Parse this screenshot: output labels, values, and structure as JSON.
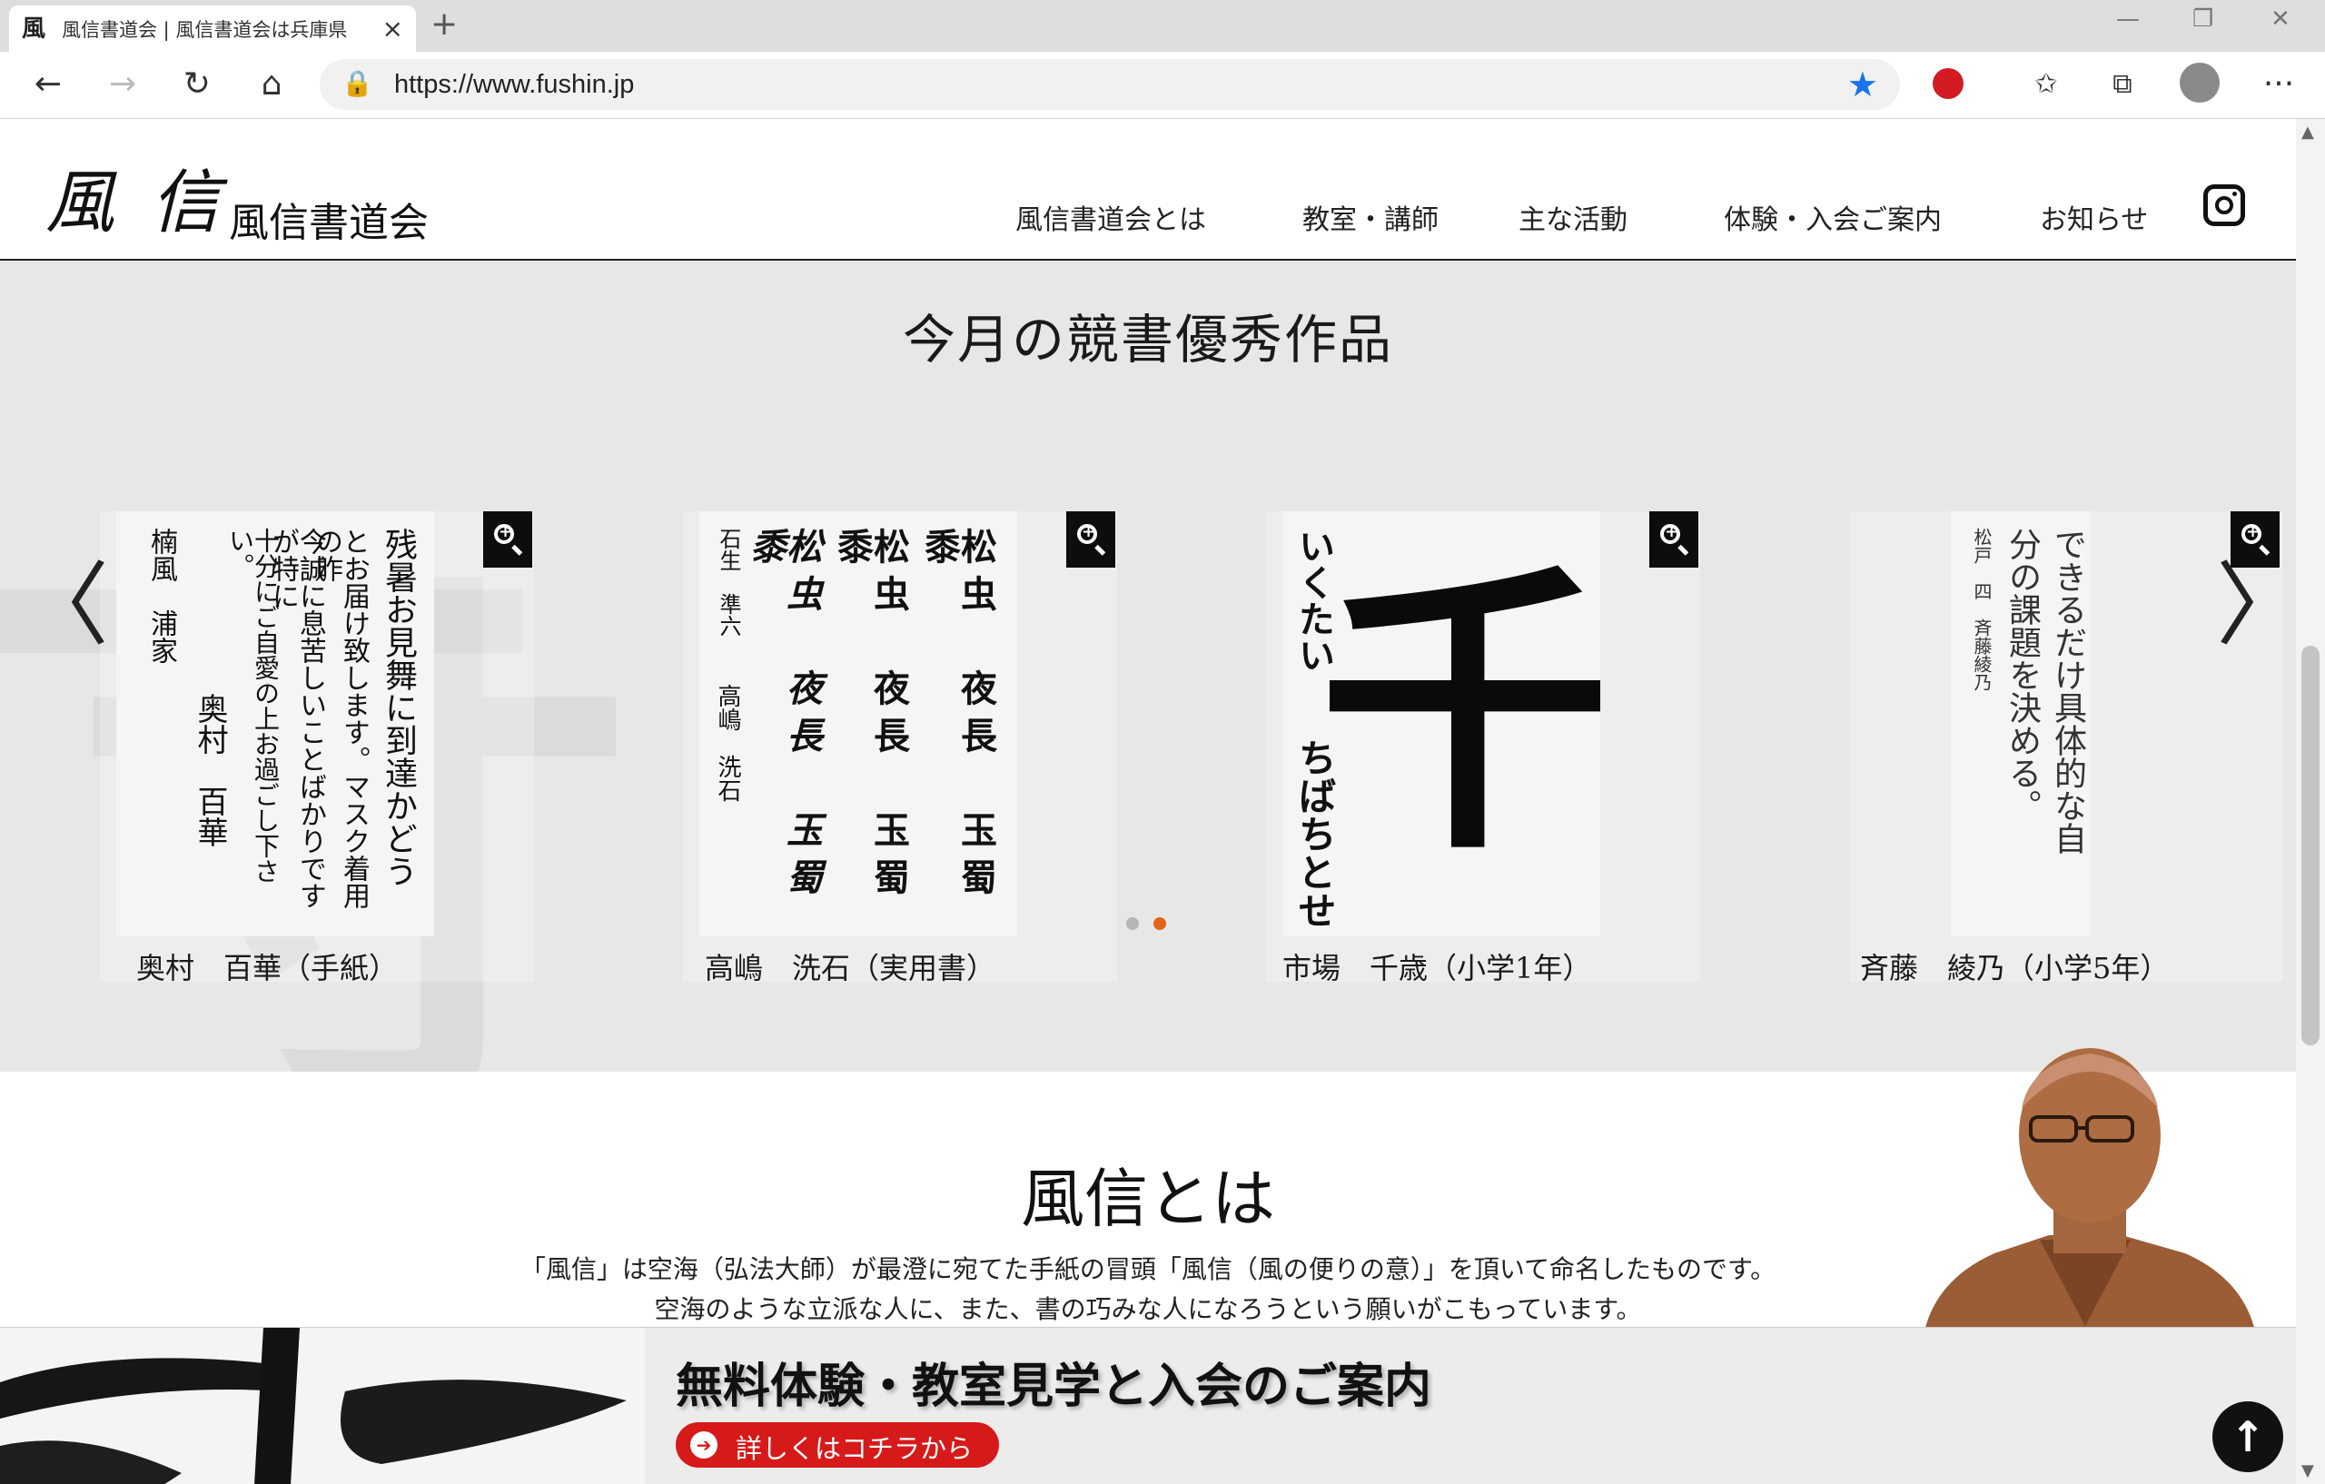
{
  "browser": {
    "tab_title": "風信書道会 | 風信書道会は兵庫県",
    "tab_favicon": "風",
    "url": "https://www.fushin.jp"
  },
  "header": {
    "logo_mark": "風信",
    "logo_text": "風信書道会",
    "nav": [
      {
        "label": "風信書道会とは"
      },
      {
        "label": "教室・講師"
      },
      {
        "label": "主な活動"
      },
      {
        "label": "体験・入会ご案内"
      },
      {
        "label": "お知らせ"
      }
    ]
  },
  "works": {
    "title": "今月の競書優秀作品",
    "items": [
      {
        "caption": "奥村　百華（手紙）",
        "art_columns": [
          "残暑お見舞に到達かどう",
          "とお届け致します。マスク着用の昨",
          "今誠に息苦しいことばかりですが特に",
          "十分にご自愛の上お過ごし下さい。",
          "楠風　浦家",
          "奥村　百華"
        ]
      },
      {
        "caption": "高嶋　洗石（実用書）",
        "art_columns": [
          "松虫　夜長　玉蜀黍",
          "松虫　夜長　玉蜀黍",
          "松虫　夜長　玉蜀黍",
          "石生　準六",
          "高嶋　洗石"
        ]
      },
      {
        "caption": "市場　千歳（小学1年）",
        "art_big": "千",
        "art_columns": [
          "いくたい",
          "ちばちとせ"
        ]
      },
      {
        "caption": "斉藤　綾乃（小学5年）",
        "art_columns": [
          "できるだけ具体的な自",
          "分の課題を決める。",
          "松戸　四　斉藤綾乃"
        ]
      }
    ]
  },
  "about": {
    "title": "風信とは",
    "p1": "「風信」は空海（弘法大師）が最澄に宛てた手紙の冒頭「風信（風の便りの意）」を頂いて命名したものです。",
    "p2": "空海のような立派な人に、また、書の巧みな人になろうという願いがこもっています。"
  },
  "cta": {
    "title": "無料体験・教室見学と入会のご案内",
    "button": "詳しくはコチラから"
  },
  "colors": {
    "accent_red": "#d61a1a",
    "dot_active": "#e0641c",
    "dot_inactive": "#b5b5b5",
    "favorite_star": "#1a73e8"
  },
  "icons": {
    "back": "←",
    "forward": "→",
    "reload": "↻",
    "home": "⌂",
    "lock": "🔒",
    "star": "★",
    "menu": "···",
    "close": "×",
    "new_tab": "+",
    "minimize": "—",
    "restore": "❐",
    "window_close": "✕",
    "prev": "〈",
    "next": "〉",
    "to_top": "↑",
    "cta_arrow": "➔"
  }
}
